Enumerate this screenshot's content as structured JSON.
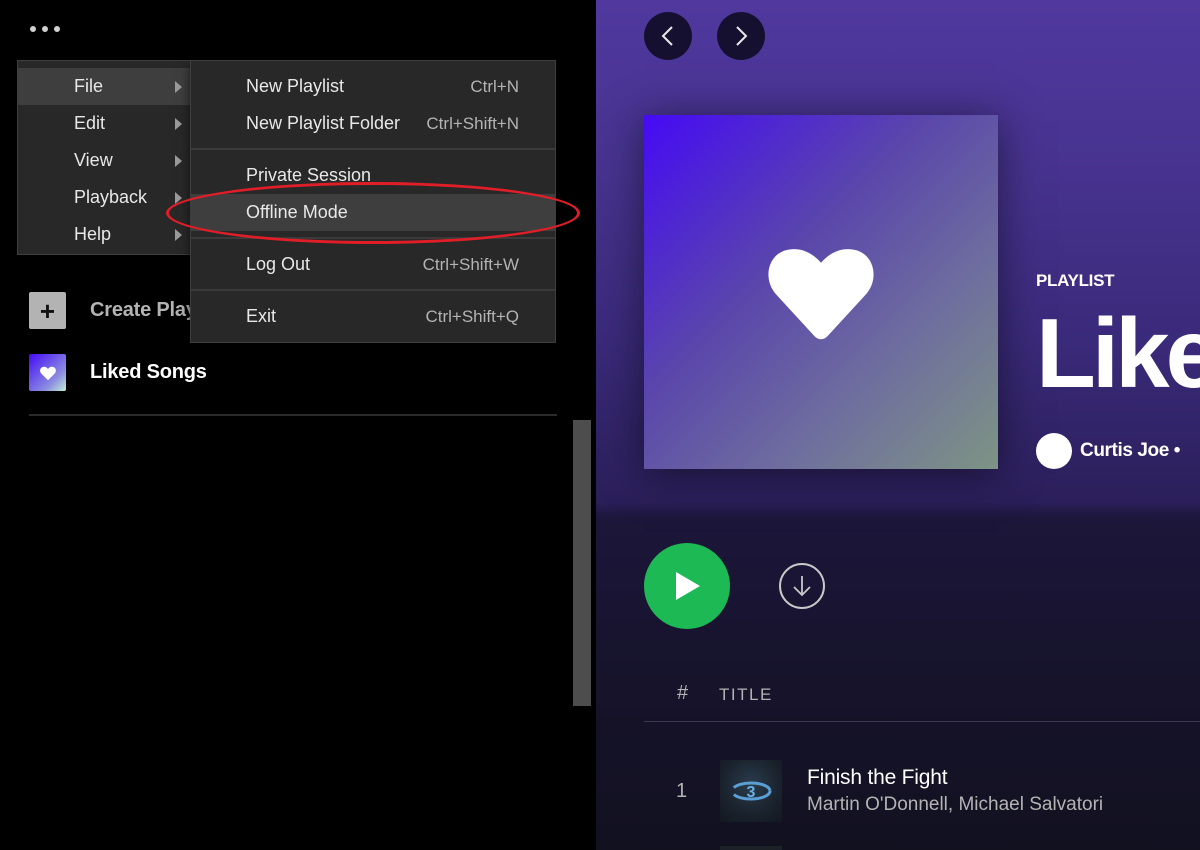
{
  "sidebar": {
    "more_menu_icon": "ellipsis-icon",
    "items": [
      {
        "label": "Create Playlist",
        "icon": "plus-icon"
      },
      {
        "label": "Liked Songs",
        "icon": "heart-icon"
      }
    ]
  },
  "app_menu": {
    "items": [
      {
        "label": "File",
        "has_submenu": true,
        "active": true
      },
      {
        "label": "Edit",
        "has_submenu": true
      },
      {
        "label": "View",
        "has_submenu": true
      },
      {
        "label": "Playback",
        "has_submenu": true
      },
      {
        "label": "Help",
        "has_submenu": true
      }
    ]
  },
  "file_menu": {
    "items": [
      {
        "label": "New Playlist",
        "shortcut": "Ctrl+N"
      },
      {
        "label": "New Playlist Folder",
        "shortcut": "Ctrl+Shift+N"
      },
      {
        "label": "Private Session",
        "shortcut": ""
      },
      {
        "label": "Offline Mode",
        "shortcut": "",
        "highlighted": true
      },
      {
        "label": "Log Out",
        "shortcut": "Ctrl+Shift+W"
      },
      {
        "label": "Exit",
        "shortcut": "Ctrl+Shift+Q"
      }
    ]
  },
  "annotation": {
    "target": "Offline Mode",
    "color": "#e01e28"
  },
  "main": {
    "nav": {
      "back_icon": "chevron-left-icon",
      "forward_icon": "chevron-right-icon"
    },
    "playlist": {
      "type": "PLAYLIST",
      "title": "Liked Songs",
      "owner": "Curtis Joe •"
    },
    "actions": {
      "play_icon": "play-icon",
      "download_icon": "download-icon"
    },
    "table": {
      "headers": {
        "number": "#",
        "title": "TITLE"
      },
      "rows": [
        {
          "number": "1",
          "title": "Finish the Fight",
          "artists": "Martin O'Donnell, Michael Salvatori"
        }
      ]
    }
  },
  "colors": {
    "accent_green": "#1db954",
    "menu_bg": "#282828",
    "menu_hover": "#3e3e3e",
    "header_purple": "#50389e"
  }
}
